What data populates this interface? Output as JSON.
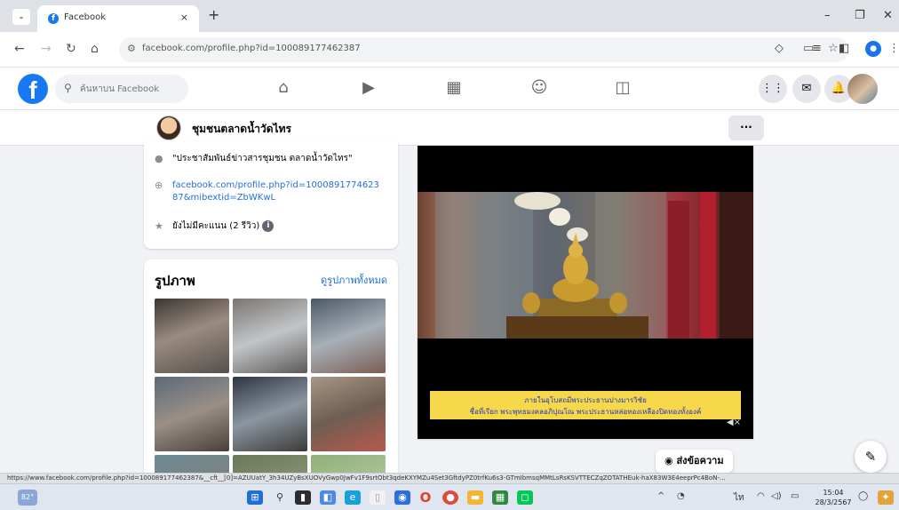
{
  "browser": {
    "tab_title": "Facebook",
    "tab_close": "×",
    "new_tab": "+",
    "url": "facebook.com/profile.php?id=100089177462387",
    "status_url": "https://www.facebook.com/profile.php?id=100089177462387&__cft__[0]=AZUUatY_3h34UZyBsXUOVyGwp0JwFv1F9srtObt3qdeKXYMZu4Set3GftdyPZ0trfKu6s3-GTmIbmsqMMtLsRsKSVTTECZqZOTATHEuk-haX83W3E4eeprPc4BoN-..."
  },
  "facebook": {
    "search_placeholder": "ค้นหาบน Facebook",
    "page_name": "ชุมชนตลาดน้ำวัดไทร",
    "more_label": "···"
  },
  "intro": {
    "quote": "\"ประชาสัมพันธ์ข่าวสารชุมชน ตลาดน้ำวัดไทร\"",
    "link": "facebook.com/profile.php?id=100089177462387&mibextid=ZbWKwL",
    "rating": "ยังไม่มีคะแนน (2 รีวิว)"
  },
  "photos": {
    "title": "รูปภาพ",
    "see_all": "ดูรูปภาพทั้งหมด",
    "thumbs": [
      "#6b625c",
      "#8a8f94",
      "#6d7a88",
      "#76706a",
      "#5d6168",
      "#8c7b70",
      "#6f7c74",
      "#7e8c76",
      "#a5b49c"
    ]
  },
  "post": {
    "caption_line1": "ภายในอุโบสถมีพระประธานปางมารวิชัย",
    "caption_line2": "ชื่อที่เรียก พระพุทธมงคลอภิปุณโณ พระประธานหล่อทองเหลืองปิดทองทั้งองค์"
  },
  "messages_button": "ส่งข้อความ",
  "taskbar": {
    "temp": "82°",
    "time": "15:04",
    "date": "28/3/2567"
  }
}
